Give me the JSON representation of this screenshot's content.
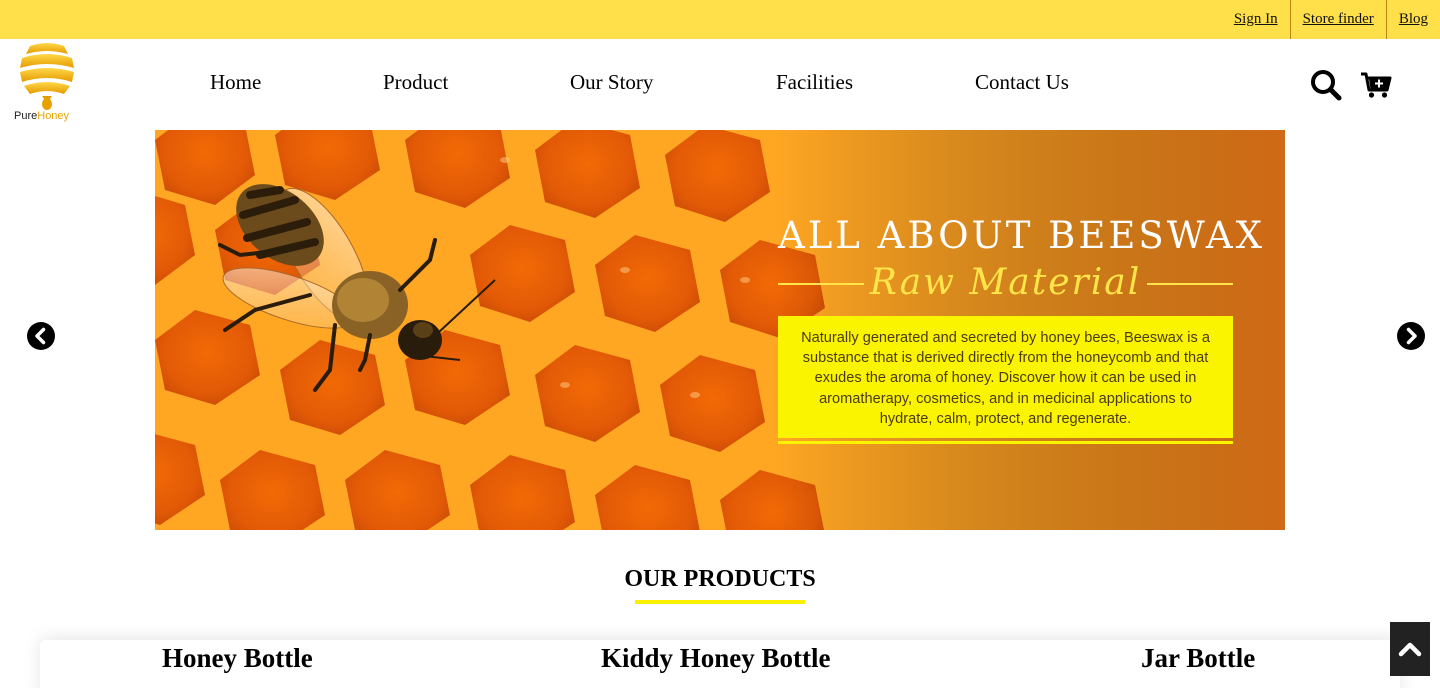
{
  "topbar": {
    "links": [
      "Sign In",
      "Store finder",
      "Blog"
    ],
    "background": "#ffe04a"
  },
  "brand": {
    "name_part1": "Pure",
    "name_part2": "Honey",
    "logo_icon": "honey-dipper-icon"
  },
  "nav": {
    "items": [
      "Home",
      "Product",
      "Our Story",
      "Facilities",
      "Contact Us"
    ]
  },
  "header_icons": {
    "search": "search-icon",
    "cart": "cart-add-icon"
  },
  "hero": {
    "title": "ALL ABOUT BEESWAX",
    "subtitle": "Raw Material",
    "description": "Naturally generated and secreted by honey bees, Beeswax is a substance that is derived directly from the honeycomb and that exudes the aroma of honey. Discover how it can be used in aromatherapy, cosmetics, and in medicinal applications to hydrate, calm, protect, and regenerate.",
    "prev_icon": "chevron-left-circle-icon",
    "next_icon": "chevron-right-circle-icon",
    "accent": "#fbf400"
  },
  "products": {
    "title": "OUR PRODUCTS",
    "items": [
      "Honey Bottle",
      "Kiddy Honey Bottle",
      "Jar Bottle"
    ]
  },
  "back_to_top_icon": "chevron-up-icon"
}
